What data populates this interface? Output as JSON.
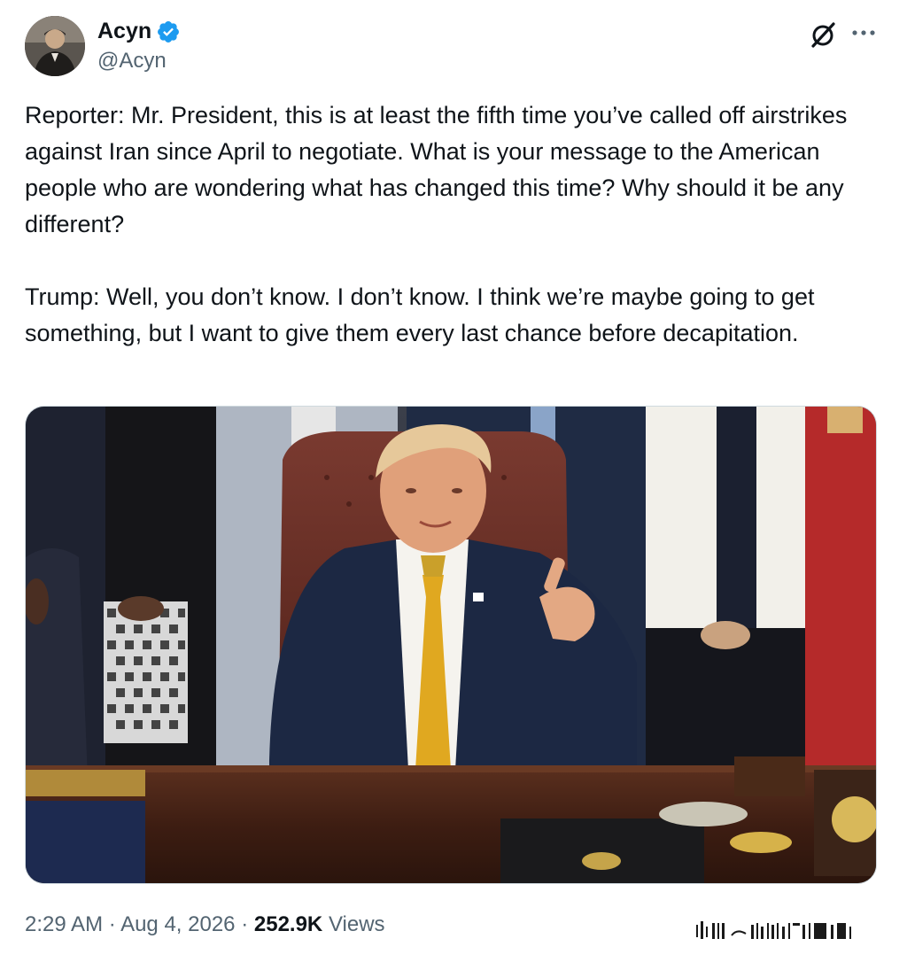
{
  "author": {
    "display_name": "Acyn",
    "handle": "@Acyn",
    "verified": true,
    "verified_color": "#1d9bf0"
  },
  "tweet": {
    "paragraphs": [
      "Reporter: Mr. President, this is at least the fifth time you’ve called off airstrikes against Iran since April to negotiate. What is your message to the American people who are wondering what has changed this time? Why should it be any different?",
      "Trump: Well, you don’t know. I don’t know. I think we’re maybe going to get something, but I want to give them every last chance before decapitation."
    ]
  },
  "meta": {
    "time": "2:29 AM",
    "separator": "·",
    "date": "Aug 4, 2026",
    "views_count": "252.9K",
    "views_label": "Views"
  },
  "icons": {
    "header_actions": [
      "grok-icon",
      "more-icon"
    ]
  }
}
